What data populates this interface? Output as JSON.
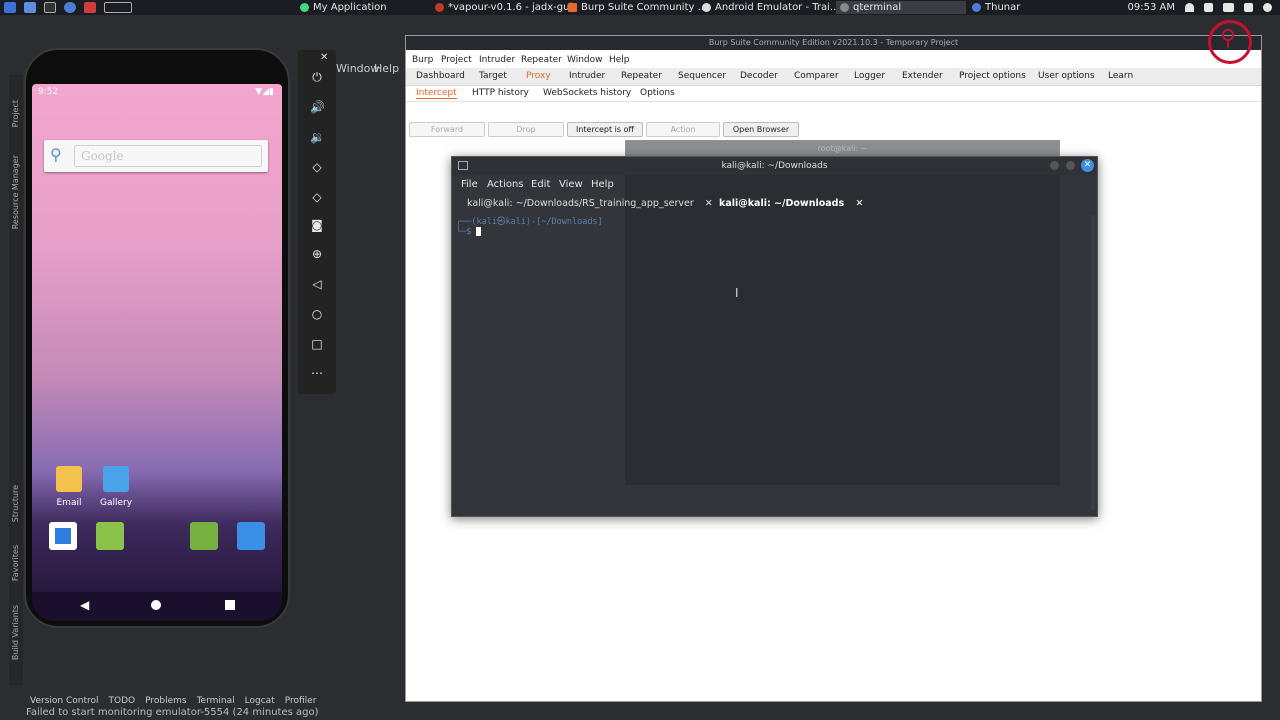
{
  "taskbar": {
    "tasks": [
      "My Application",
      "*vapour-v0.1.6 - jadx-gui",
      "Burp Suite Community ...",
      "Android Emulator - Trai...",
      "qterminal",
      "Thunar"
    ],
    "time": "09:53 AM"
  },
  "ide": {
    "menu_window": "Window",
    "menu_help": "Help",
    "side_labels": [
      "Project",
      "Resource Manager",
      "Structure",
      "Favorites",
      "Build Variants"
    ],
    "bottom_tabs": [
      "Version Control",
      "TODO",
      "Problems",
      "Terminal",
      "Logcat",
      "Profiler"
    ],
    "status": "Failed to start monitoring emulator-5554 (24 minutes ago)"
  },
  "phone": {
    "time": "9:52",
    "search_placeholder": "Google",
    "apps": [
      {
        "label": "Email",
        "color": "#f2c24c"
      },
      {
        "label": "Gallery",
        "color": "#4aa3e8"
      }
    ],
    "dock": [
      {
        "icon": "phone-icon",
        "color": "#2f7de1"
      },
      {
        "icon": "contacts-icon",
        "color": "#8bc34a"
      },
      {
        "icon": "android-icon",
        "color": "#78b13f"
      },
      {
        "icon": "camera-icon",
        "color": "#3b8fe6"
      }
    ]
  },
  "emulator_toolbar": {
    "icons": [
      "power-icon",
      "volume-up-icon",
      "volume-down-icon",
      "rotate-left-icon",
      "rotate-right-icon",
      "screenshot-icon",
      "zoom-icon",
      "back-icon",
      "home-icon",
      "overview-icon",
      "more-icon"
    ]
  },
  "burp": {
    "title": "Burp Suite Community Edition v2021.10.3 - Temporary Project",
    "menu": [
      "Burp",
      "Project",
      "Intruder",
      "Repeater",
      "Window",
      "Help"
    ],
    "tabs": [
      "Dashboard",
      "Target",
      "Proxy",
      "Intruder",
      "Repeater",
      "Sequencer",
      "Decoder",
      "Comparer",
      "Logger",
      "Extender",
      "Project options",
      "User options",
      "Learn"
    ],
    "active_tab": "Proxy",
    "subtabs": [
      "Intercept",
      "HTTP history",
      "WebSockets history",
      "Options"
    ],
    "buttons": {
      "forward": "Forward",
      "drop": "Drop",
      "intercept": "Intercept is off",
      "action": "Action",
      "open_browser": "Open Browser"
    }
  },
  "ghost_terminal": {
    "title": "root@kali: ~"
  },
  "terminal": {
    "title": "kali@kali: ~/Downloads",
    "menu": [
      "File",
      "Actions",
      "Edit",
      "View",
      "Help"
    ],
    "tabs": [
      {
        "label": "kali@kali: ~/Downloads/RS_training_app_server"
      },
      {
        "label": "kali@kali: ~/Downloads"
      }
    ],
    "prompt_line": "┌──(kali㉿kali)-[~/Downloads]",
    "prompt_tail": "└─$"
  },
  "colors": {
    "burp_accent": "#e8672a",
    "search_ring": "#c8102e"
  }
}
